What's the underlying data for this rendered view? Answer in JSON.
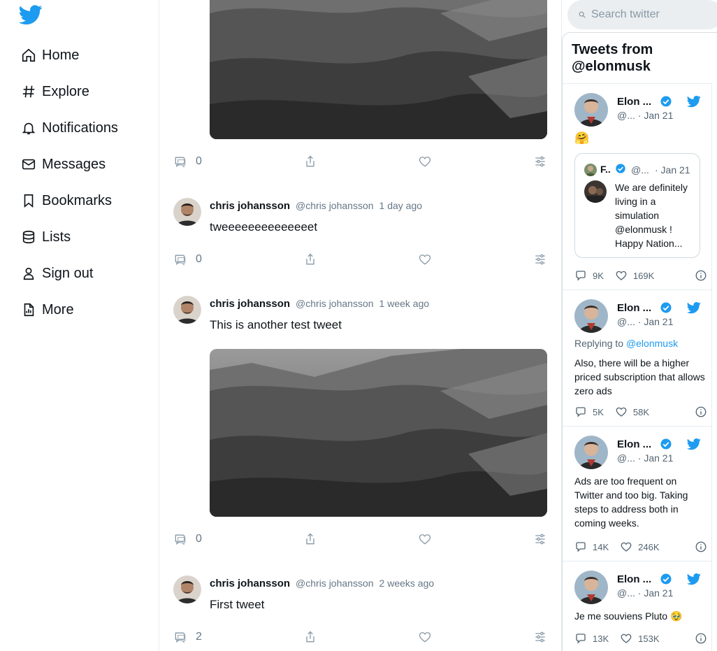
{
  "app": {
    "logo_icon": "twitter-bird-icon",
    "brand_color": "#1d9bf0"
  },
  "nav": {
    "items": [
      {
        "label": "Home",
        "icon": "home-icon"
      },
      {
        "label": "Explore",
        "icon": "hash-icon"
      },
      {
        "label": "Notifications",
        "icon": "bell-icon"
      },
      {
        "label": "Messages",
        "icon": "mail-icon"
      },
      {
        "label": "Bookmarks",
        "icon": "bookmark-icon"
      },
      {
        "label": "Lists",
        "icon": "lists-icon"
      },
      {
        "label": "Sign out",
        "icon": "user-icon"
      },
      {
        "label": "More",
        "icon": "more-icon"
      }
    ]
  },
  "feed": {
    "top_actions": {
      "comments": "0"
    },
    "tweets": [
      {
        "name": "chris johansson",
        "handle": "@chris johansson",
        "time": "1 day ago",
        "text": "tweeeeeeeeeeeeeet",
        "comments": "0",
        "has_image": false
      },
      {
        "name": "chris johansson",
        "handle": "@chris johansson",
        "time": "1 week ago",
        "text": "This is another test tweet",
        "comments": "0",
        "has_image": true
      },
      {
        "name": "chris johansson",
        "handle": "@chris johansson",
        "time": "2 weeks ago",
        "text": "First tweet",
        "comments": "2",
        "has_image": false
      }
    ]
  },
  "search": {
    "placeholder": "Search twitter"
  },
  "timeline": {
    "title": "Tweets from @elonmusk",
    "tweets": [
      {
        "name": "Elon ...",
        "meta": "@... · Jan 21",
        "text": "🤗",
        "replies": "9K",
        "likes": "169K",
        "quote": {
          "name": "F..",
          "handle": "@...",
          "time": "· Jan 21",
          "text": "We are definitely living in a simulation @elonmusk ! Happy Nation..."
        }
      },
      {
        "name": "Elon ...",
        "meta": "@... · Jan 21",
        "reply_prefix": "Replying to",
        "reply_to": "@elonmusk",
        "text": "Also, there will be a higher priced subscription that allows zero ads",
        "replies": "5K",
        "likes": "58K"
      },
      {
        "name": "Elon ...",
        "meta": "@... · Jan 21",
        "text": "Ads are too frequent on Twitter and too big. Taking steps to address both in coming weeks.",
        "replies": "14K",
        "likes": "246K"
      },
      {
        "name": "Elon ...",
        "meta": "@... · Jan 21",
        "text": "Je me souviens Pluto 🥹",
        "replies": "13K",
        "likes": "153K"
      }
    ]
  }
}
